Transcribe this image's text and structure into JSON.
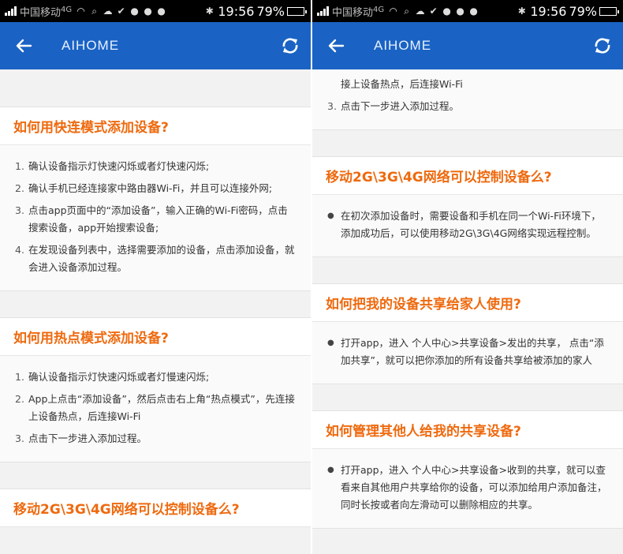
{
  "status": {
    "carrier": "中国移动",
    "network": "4G",
    "time": "19:56",
    "battery": "79%",
    "battery_level": 0.79,
    "icons": [
      "wifi-icon",
      "search-icon",
      "cloud-icon",
      "shield-check-icon",
      "wechat-icon",
      "wechat-icon",
      "wechat-icon",
      "bluetooth-icon"
    ]
  },
  "app": {
    "title": "AIHOME",
    "accent_color": "#ee6a0f",
    "bar_color": "#1a63c4"
  },
  "left": {
    "sections": [
      {
        "title": "如何用快连模式添加设备?",
        "items": [
          "确认设备指示灯快速闪烁或者灯快速闪烁;",
          "确认手机已经连接家中路由器Wi-Fi，并且可以连接外网;",
          "点击app页面中的“添加设备”，输入正确的Wi-Fi密码，点击搜索设备，app开始搜索设备;",
          "在发现设备列表中，选择需要添加的设备，点击添加设备，就会进入设备添加过程。"
        ]
      },
      {
        "title": "如何用热点模式添加设备?",
        "items": [
          "确认设备指示灯快速闪烁或者灯慢速闪烁;",
          "App上点击“添加设备”，然后点击右上角“热点模式”，先连接上设备热点，后连接Wi-Fi",
          "点击下一步进入添加过程。"
        ]
      },
      {
        "title": "移动2G\\3G\\4G网络可以控制设备么?"
      }
    ]
  },
  "right": {
    "continued_items": [
      "接上设备热点，后连接Wi-Fi",
      "点击下一步进入添加过程。"
    ],
    "sections": [
      {
        "title": "移动2G\\3G\\4G网络可以控制设备么?",
        "bullets": [
          "在初次添加设备时，需要设备和手机在同一个Wi-Fi环境下，添加成功后，可以使用移动2G\\3G\\4G网络实现远程控制。"
        ]
      },
      {
        "title": "如何把我的设备共享给家人使用?",
        "bullets": [
          "打开app，进入 个人中心>共享设备>发出的共享， 点击“添加共享”，就可以把你添加的所有设备共享给被添加的家人"
        ]
      },
      {
        "title": "如何管理其他人给我的共享设备?",
        "bullets": [
          "打开app，进入 个人中心>共享设备>收到的共享，就可以查看来自其他用户共享给你的设备，可以添加给用户添加备注，同时长按或者向左滑动可以删除相应的共享。"
        ]
      }
    ]
  }
}
